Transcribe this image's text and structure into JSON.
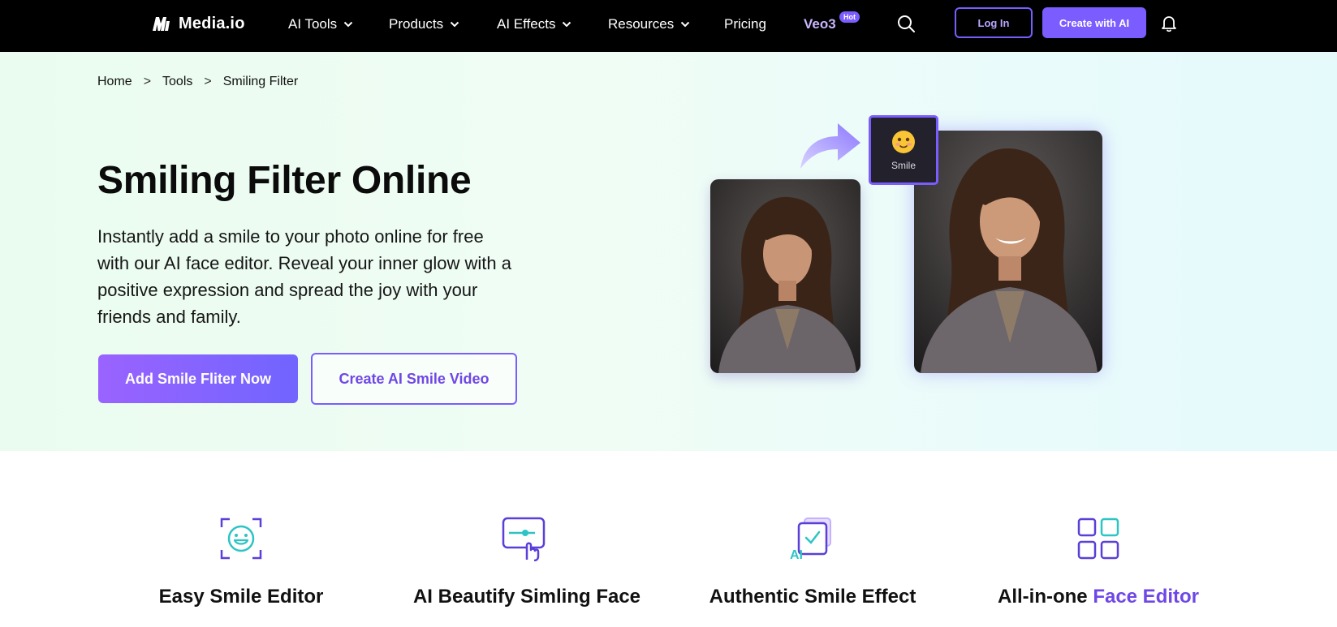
{
  "nav": {
    "logo_text": "Media.io",
    "items": [
      {
        "label": "AI Tools"
      },
      {
        "label": "Products"
      },
      {
        "label": "AI Effects"
      },
      {
        "label": "Resources"
      },
      {
        "label": "Pricing"
      }
    ],
    "veo_label": "Veo3",
    "hot_badge": "Hot",
    "login_label": "Log In",
    "create_label": "Create with AI"
  },
  "breadcrumb": {
    "home": "Home",
    "sep": ">",
    "tools": "Tools",
    "current": "Smiling Filter"
  },
  "hero": {
    "title": "Smiling Filter Online",
    "description": "Instantly add a smile to your photo online for free with our AI face editor. Reveal your inner glow with a positive expression and spread the joy with your friends and family.",
    "primary_button": "Add Smile Fliter Now",
    "secondary_button": "Create AI Smile Video",
    "smile_label": "Smile"
  },
  "features": [
    {
      "title": "Easy Smile Editor",
      "icon": "smile-face-frame-icon"
    },
    {
      "title": "AI Beautify Simling Face",
      "icon": "slider-touch-icon"
    },
    {
      "title": "Authentic Smile Effect",
      "icon": "ai-check-layers-icon"
    },
    {
      "title_prefix": "All-in-one ",
      "title_accent": "Face Editor",
      "icon": "grid-apps-icon"
    }
  ],
  "colors": {
    "accent": "#7b5cff",
    "accent_text": "#6f47e6",
    "teal": "#2ec4c4",
    "nav_bg": "#000000"
  }
}
